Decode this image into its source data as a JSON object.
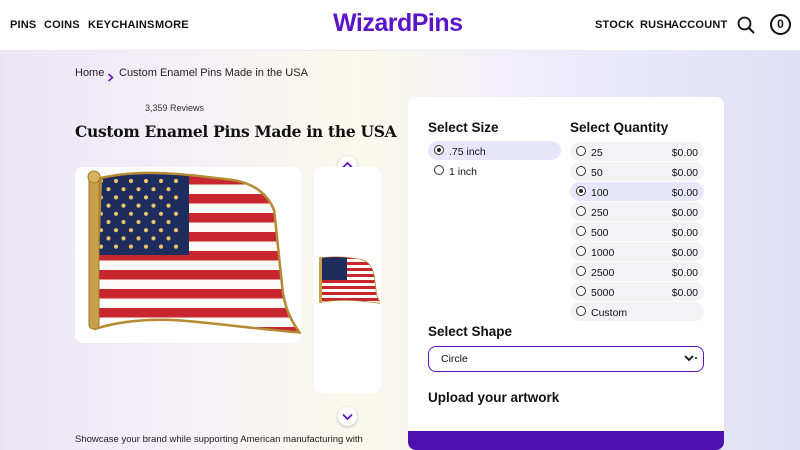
{
  "header": {
    "nav_left": [
      "PINS",
      "COINS",
      "KEYCHAINS",
      "MORE"
    ],
    "logo": "WizardPins",
    "nav_right": [
      "STOCK",
      "RUSH",
      "ACCOUNT"
    ],
    "cart_count": "0",
    "icons": [
      "search-icon",
      "cart-icon"
    ]
  },
  "breadcrumb": {
    "home": "Home",
    "current": "Custom Enamel Pins Made in the USA",
    "separator_icon": "chevron-right-icon"
  },
  "product": {
    "reviews": "3,359 Reviews",
    "title": "Custom Enamel Pins Made in the USA",
    "description": "Showcase your brand while supporting American manufacturing with",
    "image": "american-flag-pin",
    "thumbnail": "american-flag-pin-thumbnail"
  },
  "panel": {
    "size": {
      "heading": "Select Size",
      "options": [
        ".75 inch",
        "1 inch"
      ],
      "selected": ".75 inch"
    },
    "quantity": {
      "heading": "Select Quantity",
      "options": [
        {
          "label": "25",
          "price": "$0.00"
        },
        {
          "label": "50",
          "price": "$0.00"
        },
        {
          "label": "100",
          "price": "$0.00"
        },
        {
          "label": "250",
          "price": "$0.00"
        },
        {
          "label": "500",
          "price": "$0.00"
        },
        {
          "label": "1000",
          "price": "$0.00"
        },
        {
          "label": "2500",
          "price": "$0.00"
        },
        {
          "label": "5000",
          "price": "$0.00"
        },
        {
          "label": "Custom",
          "price": ""
        }
      ],
      "selected": "100"
    },
    "shape": {
      "heading": "Select Shape",
      "value": "Circle"
    },
    "upload": {
      "heading": "Upload your artwork"
    }
  },
  "colors": {
    "brand": "#5b14c6",
    "selected_option": "#e8e6fa",
    "option_bg": "#f3f3f6",
    "bottom_bar": "#4f0fb0"
  }
}
